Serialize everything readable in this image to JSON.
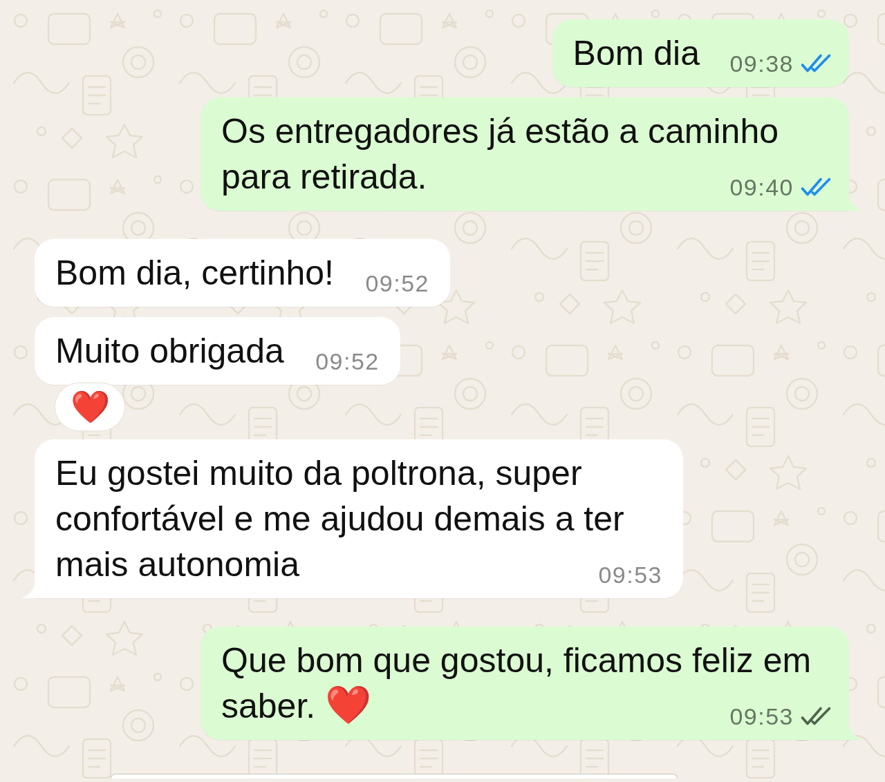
{
  "messages": [
    {
      "kind": "outgoing",
      "text": "Bom dia",
      "time": "09:38",
      "read": true,
      "tail": false
    },
    {
      "kind": "outgoing",
      "text": "Os entregadores já estão a caminho para retirada.",
      "time": "09:40",
      "read": true,
      "tail": true
    },
    {
      "kind": "incoming",
      "text": "Bom dia, certinho!",
      "time": "09:52",
      "tail": false
    },
    {
      "kind": "incoming",
      "text": "Muito obrigada",
      "time": "09:52",
      "tail": false,
      "reaction": "❤️"
    },
    {
      "kind": "incoming",
      "text": "Eu gostei muito da poltrona, super confortável e me ajudou demais a ter mais autonomia",
      "time": "09:53",
      "tail": true
    },
    {
      "kind": "outgoing",
      "text": "Que bom que gostou, ficamos feliz em saber.",
      "emoji": "❤️",
      "time": "09:53",
      "read": false,
      "tail": true
    }
  ]
}
